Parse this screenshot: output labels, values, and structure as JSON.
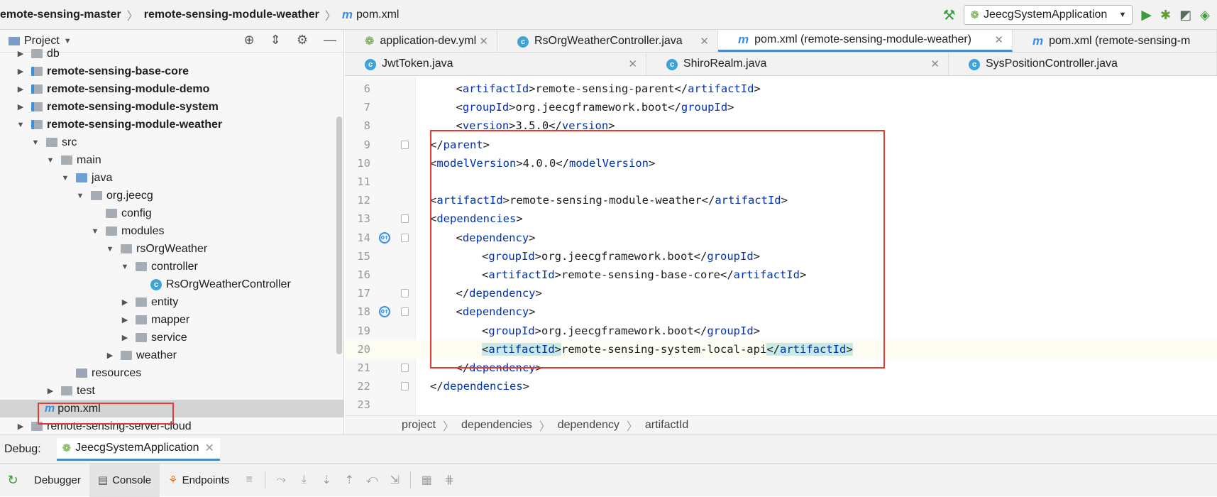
{
  "navbar": {
    "crumbs": [
      "emote-sensing-master",
      "remote-sensing-module-weather"
    ],
    "file": "pom.xml",
    "run_config": "JeecgSystemApplication"
  },
  "project": {
    "title": "Project",
    "tree": [
      {
        "label": "db",
        "depth": 0,
        "arrow": "right",
        "kind": "folder"
      },
      {
        "label": "remote-sensing-base-core",
        "depth": 0,
        "arrow": "right",
        "kind": "module",
        "bold": true
      },
      {
        "label": "remote-sensing-module-demo",
        "depth": 0,
        "arrow": "right",
        "kind": "module",
        "bold": true
      },
      {
        "label": "remote-sensing-module-system",
        "depth": 0,
        "arrow": "right",
        "kind": "module",
        "bold": true
      },
      {
        "label": "remote-sensing-module-weather",
        "depth": 0,
        "arrow": "down",
        "kind": "module",
        "bold": true
      },
      {
        "label": "src",
        "depth": 1,
        "arrow": "down",
        "kind": "folder"
      },
      {
        "label": "main",
        "depth": 2,
        "arrow": "down",
        "kind": "folder"
      },
      {
        "label": "java",
        "depth": 3,
        "arrow": "down",
        "kind": "blue"
      },
      {
        "label": "org.jeecg",
        "depth": 4,
        "arrow": "down",
        "kind": "package"
      },
      {
        "label": "config",
        "depth": 5,
        "arrow": "",
        "kind": "package"
      },
      {
        "label": "modules",
        "depth": 5,
        "arrow": "down",
        "kind": "package"
      },
      {
        "label": "rsOrgWeather",
        "depth": 6,
        "arrow": "down",
        "kind": "package"
      },
      {
        "label": "controller",
        "depth": 7,
        "arrow": "down",
        "kind": "package"
      },
      {
        "label": "RsOrgWeatherController",
        "depth": 8,
        "arrow": "",
        "kind": "class"
      },
      {
        "label": "entity",
        "depth": 7,
        "arrow": "right",
        "kind": "package"
      },
      {
        "label": "mapper",
        "depth": 7,
        "arrow": "right",
        "kind": "package"
      },
      {
        "label": "service",
        "depth": 7,
        "arrow": "right",
        "kind": "package"
      },
      {
        "label": "weather",
        "depth": 6,
        "arrow": "right",
        "kind": "package"
      },
      {
        "label": "resources",
        "depth": 3,
        "arrow": "",
        "kind": "res"
      },
      {
        "label": "test",
        "depth": 2,
        "arrow": "right",
        "kind": "folder"
      },
      {
        "label": "pom.xml",
        "depth": 1,
        "arrow": "",
        "kind": "maven",
        "selected": true
      },
      {
        "label": "remote-sensing-server-cloud",
        "depth": 0,
        "arrow": "right",
        "kind": "folder"
      }
    ]
  },
  "tabs_row1": [
    {
      "label": "application-dev.yml",
      "icon": "yml"
    },
    {
      "label": "RsOrgWeatherController.java",
      "icon": "class"
    },
    {
      "label": "pom.xml (remote-sensing-module-weather)",
      "icon": "maven",
      "active": true
    },
    {
      "label": "pom.xml (remote-sensing-m",
      "icon": "maven"
    }
  ],
  "tabs_row2": [
    {
      "label": "JwtToken.java",
      "icon": "class"
    },
    {
      "label": "ShiroRealm.java",
      "icon": "class"
    },
    {
      "label": "SysPositionController.java",
      "icon": "class"
    }
  ],
  "editor": {
    "lines": [
      {
        "n": "6",
        "indent": 1,
        "tag": "artifactId",
        "text": "remote-sensing-parent",
        "kind": "full"
      },
      {
        "n": "7",
        "indent": 1,
        "tag": "groupId",
        "text": "org.jeecgframework.boot",
        "kind": "full"
      },
      {
        "n": "8",
        "indent": 1,
        "tag": "version",
        "text": "3.5.0",
        "kind": "full"
      },
      {
        "n": "9",
        "indent": 0,
        "tag": "parent",
        "text": "",
        "kind": "close",
        "fold": true
      },
      {
        "n": "10",
        "indent": 0,
        "tag": "modelVersion",
        "text": "4.0.0",
        "kind": "full"
      },
      {
        "n": "11",
        "indent": 0,
        "tag": "",
        "text": "",
        "kind": "empty"
      },
      {
        "n": "12",
        "indent": 0,
        "tag": "artifactId",
        "text": "remote-sensing-module-weather",
        "kind": "full"
      },
      {
        "n": "13",
        "indent": 0,
        "tag": "dependencies",
        "text": "",
        "kind": "open",
        "fold": true
      },
      {
        "n": "14",
        "indent": 1,
        "tag": "dependency",
        "text": "",
        "kind": "open",
        "fold": true,
        "mark": true
      },
      {
        "n": "15",
        "indent": 2,
        "tag": "groupId",
        "text": "org.jeecgframework.boot",
        "kind": "full"
      },
      {
        "n": "16",
        "indent": 2,
        "tag": "artifactId",
        "text": "remote-sensing-base-core",
        "kind": "full"
      },
      {
        "n": "17",
        "indent": 1,
        "tag": "dependency",
        "text": "",
        "kind": "close",
        "fold": true
      },
      {
        "n": "18",
        "indent": 1,
        "tag": "dependency",
        "text": "",
        "kind": "open",
        "fold": true,
        "mark": true
      },
      {
        "n": "19",
        "indent": 2,
        "tag": "groupId",
        "text": "org.jeecgframework.boot",
        "kind": "full"
      },
      {
        "n": "20",
        "indent": 2,
        "tag": "artifactId",
        "text": "remote-sensing-system-local-api",
        "kind": "full",
        "current": true
      },
      {
        "n": "21",
        "indent": 1,
        "tag": "dependency",
        "text": "",
        "kind": "close",
        "fold": true
      },
      {
        "n": "22",
        "indent": 0,
        "tag": "dependencies",
        "text": "",
        "kind": "close",
        "fold": true
      },
      {
        "n": "23",
        "indent": 0,
        "tag": "",
        "text": "",
        "kind": "empty"
      }
    ],
    "breadcrumbs": [
      "project",
      "dependencies",
      "dependency",
      "artifactId"
    ]
  },
  "debug": {
    "label": "Debug:",
    "session": "JeecgSystemApplication",
    "tabs": [
      "Debugger",
      "Console",
      "Endpoints"
    ]
  }
}
